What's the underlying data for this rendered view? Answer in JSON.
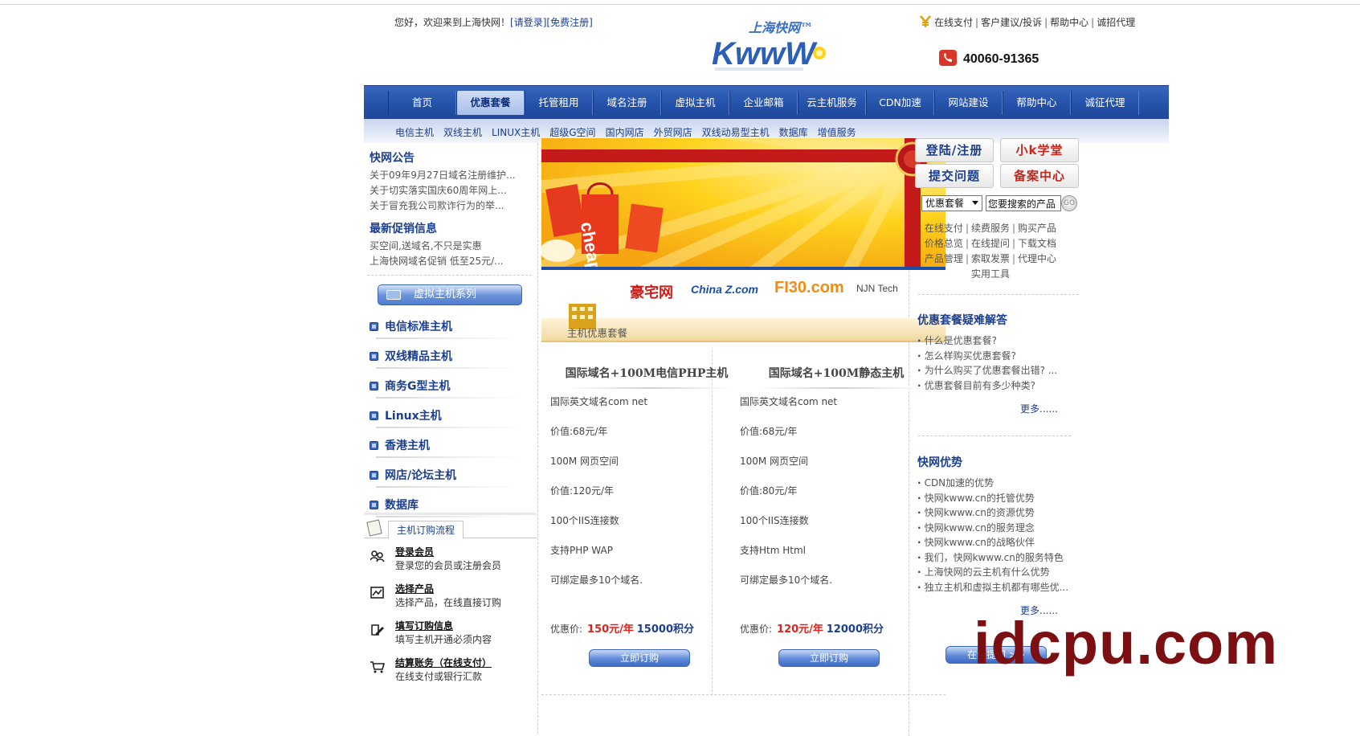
{
  "header": {
    "welcome_text": "您好，欢迎来到上海快网！",
    "login_link": "[请登录]",
    "register_link": "[免费注册]",
    "logo_cn": "上海快网™",
    "logo_en": "KwwW",
    "top_links": [
      "在线支付",
      "客户建议/投诉",
      "帮助中心",
      "诚招代理"
    ],
    "phone": "40060-91365"
  },
  "nav": {
    "items": [
      "首页",
      "优惠套餐",
      "托管租用",
      "域名注册",
      "虚拟主机",
      "企业邮箱",
      "云主机服务",
      "CDN加速",
      "网站建设",
      "帮助中心",
      "诚征代理"
    ],
    "active_index": 1
  },
  "subnav": {
    "items": [
      "电信主机",
      "双线主机",
      "LINUX主机",
      "超级G空间",
      "国内网店",
      "外贸网店",
      "双线动易型主机",
      "数据库",
      "增值服务"
    ]
  },
  "left": {
    "news_title": "快网公告",
    "news": [
      "关于09年9月27日域名注册维护...",
      "关于切实落实国庆60周年网上...",
      "关于冒充我公司欺诈行为的举..."
    ],
    "promo_title": "最新促销信息",
    "promos": [
      "买空间,送域名,不只是实惠",
      "上海快网域名促销 低至25元/..."
    ],
    "series_button": "虚拟主机系列",
    "categories": [
      "电信标准主机",
      "双线精品主机",
      "商务G型主机",
      "Linux主机",
      "香港主机",
      "网店/论坛主机",
      "数据库"
    ],
    "flow_tab": "主机订购流程",
    "steps": [
      {
        "title": "登录会员",
        "desc": "登录您的会员或注册会员"
      },
      {
        "title": "选择产品",
        "desc": "选择产品，在线直接订购"
      },
      {
        "title": "填写订购信息",
        "desc": "填写主机开通必须内容"
      },
      {
        "title": "结算账务（在线支付）",
        "desc": "在线支付或银行汇款"
      }
    ]
  },
  "center": {
    "partners": [
      "豪宅网",
      "China Z.com",
      "FI30.com",
      "NJN Tech"
    ],
    "section_title": "主机优惠套餐",
    "packages": [
      {
        "title": "国际域名+100M电信PHP主机",
        "lines": [
          "国际英文域名com net",
          "价值:68元/年",
          "100M 网页空间",
          "价值:120元/年",
          "100个IIS连接数",
          "支持PHP WAP",
          "可绑定最多10个域名."
        ],
        "price_label": "优惠价:",
        "price": "150元/年",
        "points": "15000积分",
        "button": "立即订购"
      },
      {
        "title": "国际域名+100M静态主机",
        "lines": [
          "国际英文域名com net",
          "价值:68元/年",
          "100M 网页空间",
          "价值:80元/年",
          "100个IIS连接数",
          "支持Htm Html",
          "可绑定最多10个域名."
        ],
        "price_label": "优惠价:",
        "price": "120元/年",
        "points": "12000积分",
        "button": "立即订购"
      }
    ]
  },
  "right": {
    "buttons": [
      "登陆/注册",
      "小k学堂",
      "提交问题",
      "备案中心"
    ],
    "search_select": "优惠套餐",
    "search_placeholder": "您要搜索的产品",
    "go_label": "GO",
    "quick_links_rows": [
      [
        "在线支付",
        "续费服务",
        "购买产品"
      ],
      [
        "价格总览",
        "在线提问",
        "下载文档"
      ],
      [
        "产品管理",
        "索取发票",
        "代理中心"
      ],
      [
        "实用工具"
      ]
    ],
    "faq_title": "优惠套餐疑难解答",
    "faq": [
      "什么是优惠套餐?",
      "怎么样购买优惠套餐?",
      "为什么购买了优惠套餐出错? ...",
      "优惠套餐目前有多少种类?"
    ],
    "more1": "更多......",
    "adv_title": "快网优势",
    "advantages": [
      "CDN加速的优势",
      "快网kwww.cn的托管优势",
      "快网kwww.cn的资源优势",
      "快网kwww.cn的服务理念",
      "快网kwww.cn的战略伙伴",
      "我们，快网kwww.cn的服务特色",
      "上海快网的云主机有什么优势",
      "独立主机和虚拟主机都有哪些优..."
    ],
    "more2": "更多......",
    "online_button": "在线提问 >>"
  },
  "watermark": "idcpu.com"
}
